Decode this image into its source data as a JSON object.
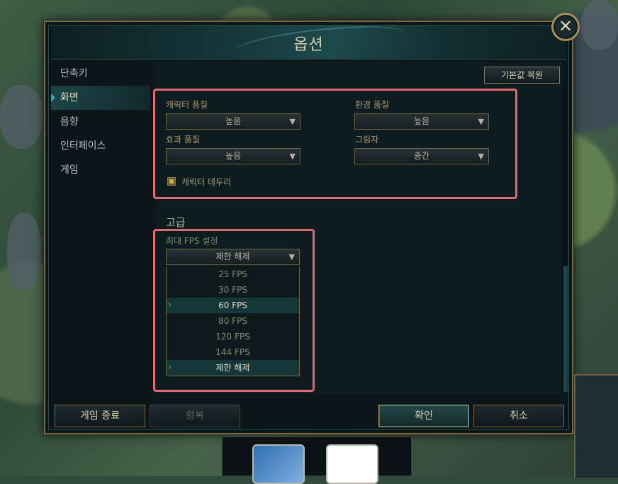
{
  "dialog": {
    "title": "옵션",
    "close_symbol": "✕"
  },
  "sidebar": {
    "items": [
      {
        "label": "단축키"
      },
      {
        "label": "화면",
        "active": true
      },
      {
        "label": "음향"
      },
      {
        "label": "인터페이스"
      },
      {
        "label": "게임"
      }
    ]
  },
  "content": {
    "restore_defaults_label": "기본값 복원",
    "quality": {
      "character_quality": {
        "label": "캐릭터 품질",
        "value": "높음"
      },
      "environment_quality": {
        "label": "환경 품질",
        "value": "높음"
      },
      "effects_quality": {
        "label": "효과 품질",
        "value": "높음"
      },
      "shadows": {
        "label": "그림자",
        "value": "중간"
      },
      "character_outline": {
        "label": "캐릭터 테두리",
        "checked": true
      }
    },
    "advanced": {
      "title": "고급",
      "max_fps": {
        "label": "최대 FPS 설정",
        "value": "제한 해제",
        "options": [
          {
            "label": "25 FPS"
          },
          {
            "label": "30 FPS"
          },
          {
            "label": "60 FPS",
            "selected": true
          },
          {
            "label": "80 FPS"
          },
          {
            "label": "120 FPS"
          },
          {
            "label": "144 FPS"
          },
          {
            "label": "제한 해제",
            "selected": true
          }
        ]
      }
    }
  },
  "footer": {
    "quit_game_label": "게임 종료",
    "surrender_label": "항복",
    "confirm_label": "확인",
    "cancel_label": "취소"
  },
  "colors": {
    "highlight_box": "#e06873",
    "accent_teal": "#43a4b0",
    "gold_border": "#7a6a3f"
  }
}
